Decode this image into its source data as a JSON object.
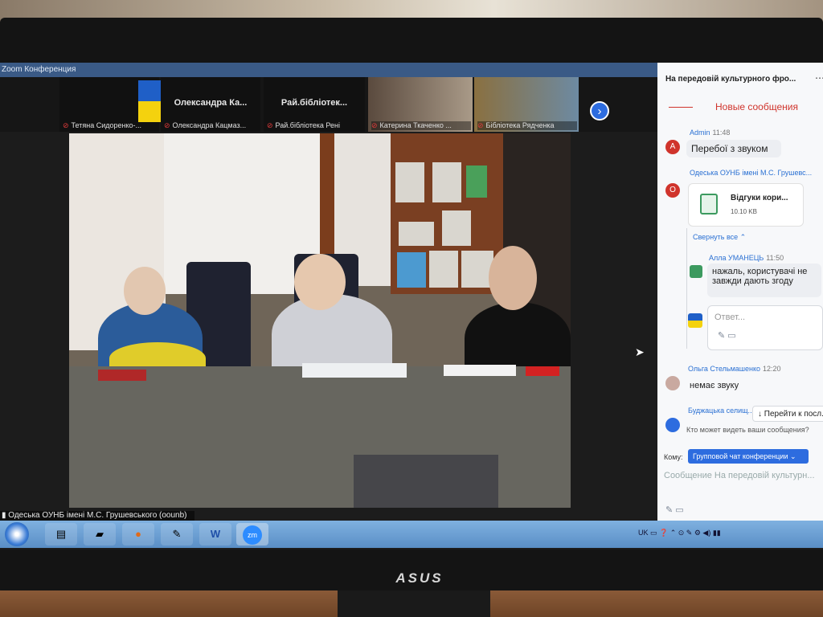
{
  "window": {
    "title": "Zoom Конференция"
  },
  "monitor": {
    "brand": "ASUS"
  },
  "participants": [
    {
      "name": "",
      "caption": "Тетяна Сидоренко-..."
    },
    {
      "name": "Олександра  Ка...",
      "caption": "Олександра Кацмаз..."
    },
    {
      "name": "Рай.бібліотек...",
      "caption": "Рай.бібліотека Рені"
    },
    {
      "name": "",
      "caption": "Катерина Ткаченко ..."
    },
    {
      "name": "",
      "caption": "Бібліотека Рядченка"
    }
  ],
  "main_video": {
    "speaker_label": "Одеська ОУНБ імені М.С. Грушевського (oounb)"
  },
  "chat": {
    "title": "На передовій культурного фро...",
    "new_messages": "Новые сообщения",
    "messages": [
      {
        "sender": "Admin",
        "time": "11:48",
        "avatar": "A",
        "avatar_color": "#d0342c",
        "text": "Перебої з звуком"
      },
      {
        "sender": "Одеська ОУНБ імені М.С. Грушевс...",
        "time": "",
        "avatar": "О",
        "avatar_color": "#d0342c",
        "file": {
          "name": "Відгуки кори...",
          "size": "10.10 KB"
        }
      }
    ],
    "collapse_label": "Свернуть все ⌃",
    "reply": {
      "sender": "Алла УМАНЕЦЬ",
      "time": "11:50",
      "text": "нажаль, користувачі не завжди дають згоду"
    },
    "reply_placeholder": "Ответ...",
    "message2": {
      "sender": "Ольга Стельмашенко",
      "time": "12:20",
      "text": "немає звуку"
    },
    "message3_sender": "Буджацька селищ...",
    "goto_label": "↓ Перейти к посл...",
    "who_sees": "Кто может видеть ваши сообщения?",
    "to_label": "Кому:",
    "to_value": "Групповой чат конференции ⌄",
    "input_placeholder": "Сообщение На передовій культурн..."
  },
  "taskbar": {
    "items": [
      "Windows",
      "Explorer",
      "Folder",
      "Firefox",
      "Paint",
      "Word",
      "Zoom"
    ],
    "tray": "UK ▭ ❓ ⌃ ⊙ ✎ ⚙ ◀) ▮▮"
  },
  "colors": {
    "accent": "#2d6cdf",
    "alert": "#d0342c",
    "taskbar": "#6a9fd3"
  }
}
